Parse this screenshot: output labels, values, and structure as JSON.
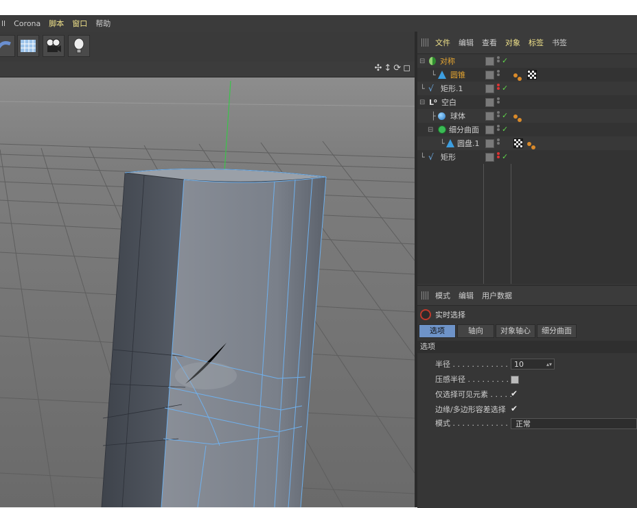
{
  "menu": {
    "items": [
      "ll",
      "Corona",
      "脚本",
      "窗口",
      "帮助"
    ]
  },
  "toolbar": {
    "buttons": [
      "spline-tool-icon",
      "floor-icon",
      "camera-icon",
      "light-icon"
    ]
  },
  "viewport": {
    "nav_icons": [
      "move-view-icon",
      "zoom-view-icon",
      "rotate-view-icon",
      "maximize-view-icon"
    ]
  },
  "object_panel": {
    "tabs": [
      "文件",
      "编辑",
      "查看",
      "对象",
      "标签",
      "书签"
    ],
    "objects": [
      {
        "name": "对称",
        "selected": true
      },
      {
        "name": "圆锥",
        "selected": true
      },
      {
        "name": "矩形.1",
        "selected": false
      },
      {
        "name": "空白",
        "selected": false
      },
      {
        "name": "球体",
        "selected": false
      },
      {
        "name": "细分曲面",
        "selected": false
      },
      {
        "name": "圆盘.1",
        "selected": false
      },
      {
        "name": "矩形",
        "selected": false
      }
    ]
  },
  "attribute_panel": {
    "tabs": [
      "模式",
      "编辑",
      "用户数据"
    ],
    "tool_name": "实时选择",
    "subtabs": [
      "选项",
      "轴向",
      "对象轴心",
      "细分曲面"
    ],
    "section": "选项",
    "radius_label": "半径 . . . . . . . . . . . . . .",
    "radius_value": "10",
    "pressure_label": "压感半径 . . . . . . . . . . .",
    "visible_only_label": "仅选择可见元素 . . . . .",
    "edge_tolerance_label": "边缘/多边形容差选择",
    "mode_label": "模式 . . . . . . . . . . . . . .",
    "mode_value": "正常"
  },
  "colors": {
    "accent": "#f0e28a",
    "selection": "#6e93c8",
    "check": "#5fd64a"
  }
}
